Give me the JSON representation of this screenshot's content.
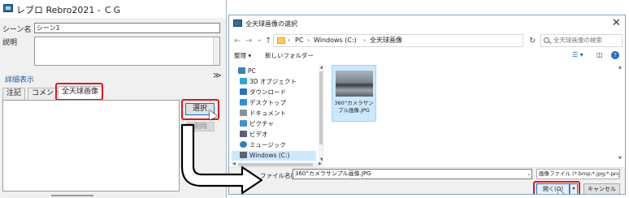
{
  "left_window": {
    "title": "レブロ Rebro2021 - ＣＧ",
    "scene_label": "シーン名",
    "scene_value": "シーン1",
    "description_label": "説明",
    "details_label": "詳細表示",
    "details_chevron": "≫",
    "tabs": [
      {
        "label": "注記"
      },
      {
        "label": "コメント"
      },
      {
        "label": "全天球画像"
      }
    ],
    "select_button": "選択",
    "clear_button": "削除"
  },
  "dialog": {
    "title": "全天球画像の選択",
    "close": "✕",
    "nav": {
      "back": "←",
      "forward": "→",
      "recent": "⌄",
      "up": "↑"
    },
    "address": {
      "segments": [
        "PC",
        "Windows (C:)",
        "全天球画像"
      ],
      "separator": "›",
      "dropdown": "⌄"
    },
    "refresh": "↻",
    "search_placeholder": "全天球画像の検索",
    "toolbar": {
      "organize": "整理 ▾",
      "new_folder": "新しいフォルダー",
      "view": "☰ ▾",
      "preview": "◫",
      "help": "?"
    },
    "nav_pane": [
      {
        "label": "PC",
        "icon": "pc-icon",
        "color": "#3c7fc1"
      },
      {
        "label": "3D オブジェクト",
        "icon": "cube-icon",
        "color": "#2da9d6"
      },
      {
        "label": "ダウンロード",
        "icon": "download-icon",
        "color": "#2d6fc1"
      },
      {
        "label": "デスクトップ",
        "icon": "desktop-icon",
        "color": "#2d8fd6"
      },
      {
        "label": "ドキュメント",
        "icon": "document-icon",
        "color": "#8a9099"
      },
      {
        "label": "ピクチャ",
        "icon": "pictures-icon",
        "color": "#4a90c8"
      },
      {
        "label": "ビデオ",
        "icon": "video-icon",
        "color": "#5a6470"
      },
      {
        "label": "ミュージック",
        "icon": "music-icon",
        "color": "#2d7fc1"
      },
      {
        "label": "Windows (C:)",
        "icon": "drive-icon",
        "color": "#5a6470",
        "selected": true
      }
    ],
    "file": {
      "name": "360°カメラサンプル画像.JPG"
    },
    "filename_label": "ファイル名(N):",
    "filename_value": "360°カメラサンプル画像.JPG",
    "filetype_value": "画像ファイル (*.bmp;*.jpg;*.png)",
    "open_button": "開く(O)",
    "open_split": "▾",
    "cancel_button": "キャンセル"
  },
  "colors": {
    "highlight_red": "#e3161b",
    "accent_blue": "#0078d7",
    "selection_blue": "#cce8ff"
  }
}
